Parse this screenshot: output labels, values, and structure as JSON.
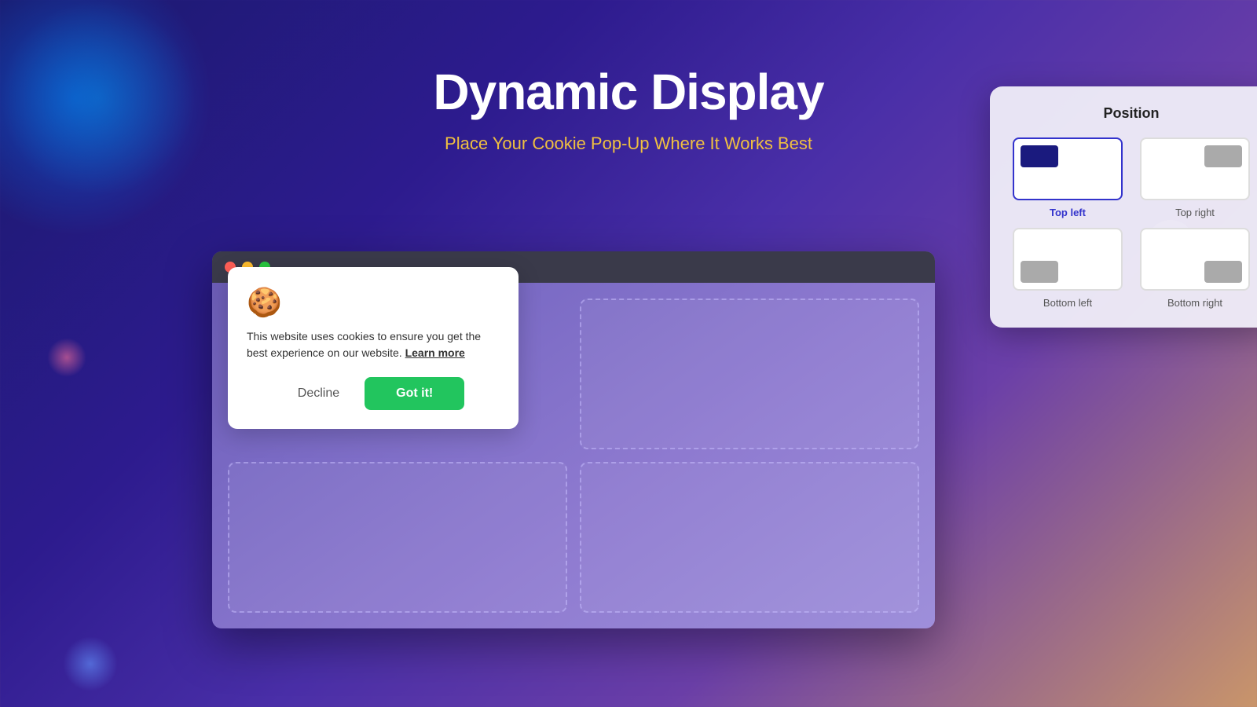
{
  "page": {
    "title": "Dynamic Display",
    "subtitle": "Place Your Cookie Pop-Up Where It Works Best"
  },
  "browser": {
    "window_buttons": [
      "red",
      "yellow",
      "green"
    ]
  },
  "cookie_popup": {
    "icon": "🍪",
    "message": "This website uses cookies to ensure you get the best experience on our website.",
    "learn_more_label": "Learn more",
    "decline_label": "Decline",
    "accept_label": "Got it!"
  },
  "position_panel": {
    "title": "Position",
    "options": [
      {
        "id": "top-left",
        "label": "Top left",
        "selected": true
      },
      {
        "id": "top-right",
        "label": "Top right",
        "selected": false
      },
      {
        "id": "bottom-left",
        "label": "Bottom left",
        "selected": false
      },
      {
        "id": "bottom-right",
        "label": "Bottom right",
        "selected": false
      }
    ]
  }
}
